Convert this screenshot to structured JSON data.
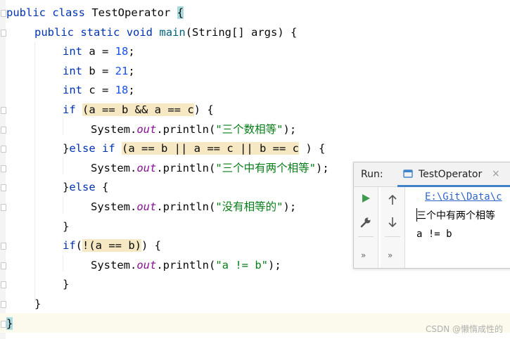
{
  "editor": {
    "code_lines": [
      {
        "indent": 0,
        "tokens": [
          {
            "t": "kw",
            "v": "public"
          },
          {
            "t": "p",
            "v": " "
          },
          {
            "t": "kw",
            "v": "class"
          },
          {
            "t": "p",
            "v": " TestOperator "
          },
          {
            "t": "brace",
            "v": "{"
          }
        ]
      },
      {
        "indent": 1,
        "tokens": [
          {
            "t": "kw",
            "v": "public"
          },
          {
            "t": "p",
            "v": " "
          },
          {
            "t": "kw",
            "v": "static"
          },
          {
            "t": "p",
            "v": " "
          },
          {
            "t": "kw",
            "v": "void"
          },
          {
            "t": "p",
            "v": " "
          },
          {
            "t": "fn",
            "v": "main"
          },
          {
            "t": "p",
            "v": "(String[] args) {"
          }
        ]
      },
      {
        "indent": 2,
        "tokens": [
          {
            "t": "kw",
            "v": "int"
          },
          {
            "t": "p",
            "v": " a = "
          },
          {
            "t": "num",
            "v": "18"
          },
          {
            "t": "p",
            "v": ";"
          }
        ]
      },
      {
        "indent": 2,
        "tokens": [
          {
            "t": "kw",
            "v": "int"
          },
          {
            "t": "p",
            "v": " b = "
          },
          {
            "t": "num",
            "v": "21"
          },
          {
            "t": "p",
            "v": ";"
          }
        ]
      },
      {
        "indent": 2,
        "tokens": [
          {
            "t": "kw",
            "v": "int"
          },
          {
            "t": "p",
            "v": " c = "
          },
          {
            "t": "num",
            "v": "18"
          },
          {
            "t": "p",
            "v": ";"
          }
        ]
      },
      {
        "indent": 2,
        "tokens": [
          {
            "t": "kw",
            "v": "if"
          },
          {
            "t": "p",
            "v": " "
          },
          {
            "t": "hl",
            "v": "(a == b && a == c"
          },
          {
            "t": "p",
            "v": ") {"
          }
        ]
      },
      {
        "indent": 3,
        "tokens": [
          {
            "t": "p",
            "v": "System."
          },
          {
            "t": "field",
            "v": "out"
          },
          {
            "t": "p",
            "v": ".println("
          },
          {
            "t": "str",
            "v": "\"三个数相等\""
          },
          {
            "t": "p",
            "v": ");"
          }
        ]
      },
      {
        "indent": 2,
        "tokens": [
          {
            "t": "p",
            "v": "}"
          },
          {
            "t": "kw",
            "v": "else"
          },
          {
            "t": "p",
            "v": " "
          },
          {
            "t": "kw",
            "v": "if"
          },
          {
            "t": "p",
            "v": " "
          },
          {
            "t": "hl",
            "v": "(a == b || a == c || b == c"
          },
          {
            "t": "p",
            "v": " ) {"
          }
        ]
      },
      {
        "indent": 3,
        "tokens": [
          {
            "t": "p",
            "v": "System."
          },
          {
            "t": "field",
            "v": "out"
          },
          {
            "t": "p",
            "v": ".println("
          },
          {
            "t": "str",
            "v": "\"三个中有两个相等\""
          },
          {
            "t": "p",
            "v": ");"
          }
        ]
      },
      {
        "indent": 2,
        "tokens": [
          {
            "t": "p",
            "v": "}"
          },
          {
            "t": "kw",
            "v": "else"
          },
          {
            "t": "p",
            "v": " {"
          }
        ]
      },
      {
        "indent": 3,
        "tokens": [
          {
            "t": "p",
            "v": "System."
          },
          {
            "t": "field",
            "v": "out"
          },
          {
            "t": "p",
            "v": ".println("
          },
          {
            "t": "str",
            "v": "\"没有相等的\""
          },
          {
            "t": "p",
            "v": ");"
          }
        ]
      },
      {
        "indent": 2,
        "tokens": [
          {
            "t": "p",
            "v": "}"
          }
        ]
      },
      {
        "indent": 2,
        "tokens": [
          {
            "t": "kw",
            "v": "if"
          },
          {
            "t": "p",
            "v": "("
          },
          {
            "t": "hl",
            "v": "!(a == b)"
          },
          {
            "t": "p",
            "v": ") {"
          }
        ]
      },
      {
        "indent": 3,
        "tokens": [
          {
            "t": "p",
            "v": "System."
          },
          {
            "t": "field",
            "v": "out"
          },
          {
            "t": "p",
            "v": ".println("
          },
          {
            "t": "str",
            "v": "\"a != b\""
          },
          {
            "t": "p",
            "v": ");"
          }
        ]
      },
      {
        "indent": 2,
        "tokens": [
          {
            "t": "p",
            "v": "}"
          }
        ]
      },
      {
        "indent": 1,
        "tokens": [
          {
            "t": "p",
            "v": "}"
          }
        ]
      },
      {
        "indent": 0,
        "tokens": [
          {
            "t": "brace",
            "v": "}"
          }
        ]
      }
    ]
  },
  "run_panel": {
    "title": "Run:",
    "tab_label": "TestOperator",
    "close_glyph": "×",
    "more_glyph": "»",
    "console": {
      "path_text": "E:\\Git\\Data\\c",
      "lines": [
        "三个中有两个相等",
        "a != b"
      ]
    }
  },
  "colors": {
    "keyword": "#0033b3",
    "number": "#1750eb",
    "method": "#00627a",
    "string": "#067d17",
    "field": "#871094",
    "highlight": "#f5e8c2",
    "brace_match": "#a8dadf",
    "run_icon": "#3f9b4f",
    "tab_underline": "#4083c9"
  },
  "icons": {
    "run": "play-icon",
    "settings": "wrench-icon",
    "up": "arrow-up-icon",
    "down": "arrow-down-icon",
    "tab": "run-config-icon"
  },
  "watermark": "CSDN @懒惰成性的"
}
